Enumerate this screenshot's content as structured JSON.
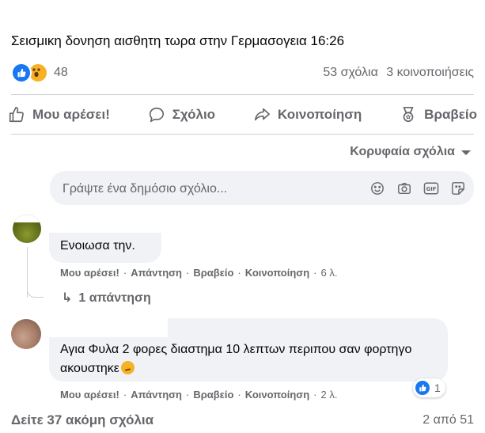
{
  "post": {
    "text": "Σεισμικη δονηση αισθητη τωρα στην Γερμασογεια 16:26",
    "reaction_count": "48",
    "comments_count": "53 σχόλια",
    "shares_count": "3 κοινοποιήσεις",
    "reaction_icons": [
      "like-icon",
      "wow-icon"
    ]
  },
  "actions": {
    "like": "Μου αρέσει!",
    "comment": "Σχόλιο",
    "share": "Κοινοποίηση",
    "award": "Βραβείο"
  },
  "sort_label": "Κορυφαία σχόλια",
  "composer": {
    "placeholder": "Γράψτε ένα δημόσιο σχόλιο...",
    "icons": [
      "emoji-icon",
      "camera-icon",
      "gif-icon",
      "sticker-icon"
    ]
  },
  "comments": [
    {
      "text": "Ενοιωσα την.",
      "actions": {
        "like": "Μου αρέσει!",
        "reply": "Απάντηση",
        "award": "Βραβείο",
        "share": "Κοινοποίηση",
        "time": "6 λ."
      },
      "replies_label": "1 απάντηση"
    },
    {
      "text": "Αγια Φυλα 2 φορες διαστημα 10 λεπτων περιπου σαν φορτηγο ακουστηκε",
      "actions": {
        "like": "Μου αρέσει!",
        "reply": "Απάντηση",
        "award": "Βραβείο",
        "share": "Κοινοποίηση",
        "time": "2 λ."
      },
      "reaction_count": "1"
    }
  ],
  "footer": {
    "more_comments": "Δείτε 37 ακόμη σχόλια",
    "pager": "2 από 51"
  },
  "colors": {
    "accent": "#1877f2",
    "secondary_text": "#65676b",
    "bubble": "#f0f2f5",
    "divider": "#ced0d4"
  }
}
